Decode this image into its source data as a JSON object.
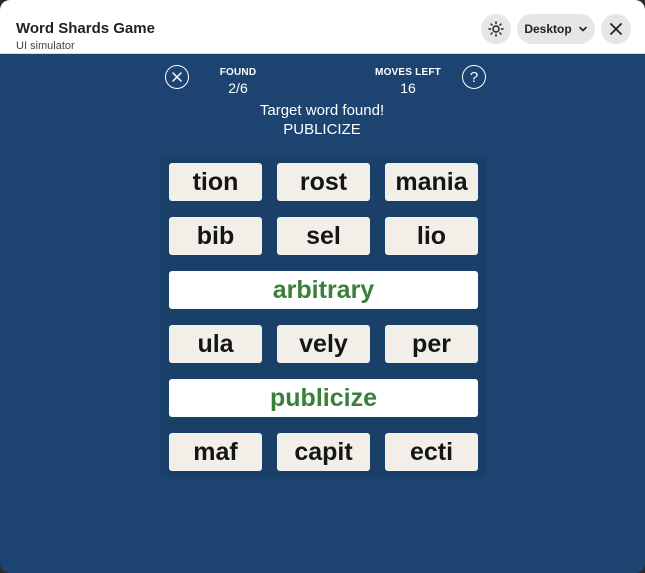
{
  "window": {
    "title": "Word Shards Game",
    "subtitle": "UI simulator"
  },
  "toolbar": {
    "device_label": "Desktop"
  },
  "stats": {
    "found_label": "FOUND",
    "found_value": "2/6",
    "moves_label": "MOVES LEFT",
    "moves_value": "16"
  },
  "status": {
    "message": "Target word found!",
    "target_word": "PUBLICIZE"
  },
  "board": {
    "row1": [
      "tion",
      "rost",
      "mania"
    ],
    "row2": [
      "bib",
      "sel",
      "lio"
    ],
    "found1": "arbitrary",
    "row4": [
      "ula",
      "vely",
      "per"
    ],
    "found2": "publicize",
    "row6": [
      "maf",
      "capit",
      "ecti"
    ]
  },
  "colors": {
    "background": "#1d4370",
    "tile": "#f2efe8",
    "found_word_text": "#3a7f3a"
  }
}
